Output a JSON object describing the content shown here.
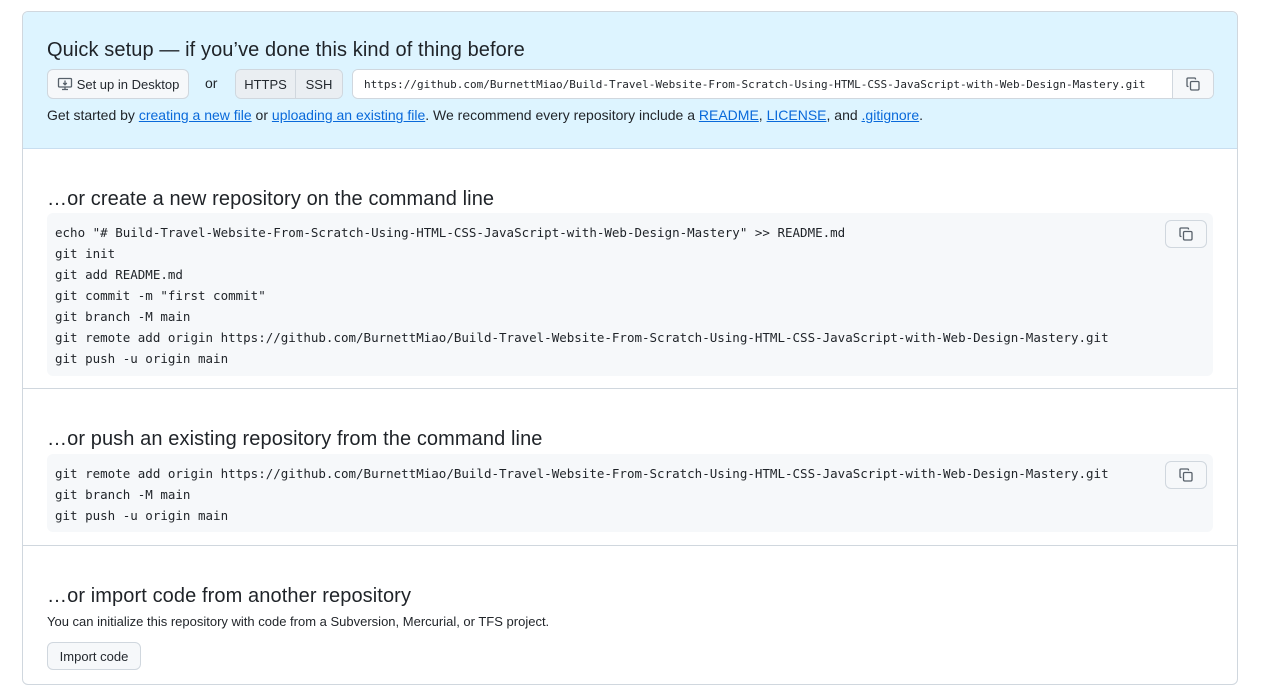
{
  "quick_setup": {
    "title": "Quick setup — if you’ve done this kind of thing before",
    "desktop_button_label": "Set up in Desktop",
    "or_label": "or",
    "protocols": [
      "HTTPS",
      "SSH"
    ],
    "clone_url": "https://github.com/BurnettMiao/Build-Travel-Website-From-Scratch-Using-HTML-CSS-JavaScript-with-Web-Design-Mastery.git",
    "copy_icon": "copy-icon",
    "get_started": {
      "prefix": "Get started by ",
      "link_new_file": "creating a new file",
      "mid1": " or ",
      "link_upload": "uploading an existing file",
      "mid2": ". We recommend every repository include a ",
      "link_readme": "README",
      "comma": ", ",
      "link_license": "LICENSE",
      "and": ", and ",
      "link_gitignore": ".gitignore",
      "end": "."
    }
  },
  "create_section": {
    "title": "…or create a new repository on the command line",
    "lines": [
      "echo \"# Build-Travel-Website-From-Scratch-Using-HTML-CSS-JavaScript-with-Web-Design-Mastery\" >> README.md",
      "git init",
      "git add README.md",
      "git commit -m \"first commit\"",
      "git branch -M main",
      "git remote add origin https://github.com/BurnettMiao/Build-Travel-Website-From-Scratch-Using-HTML-CSS-JavaScript-with-Web-Design-Mastery.git",
      "git push -u origin main"
    ]
  },
  "push_section": {
    "title": "…or push an existing repository from the command line",
    "lines": [
      "git remote add origin https://github.com/BurnettMiao/Build-Travel-Website-From-Scratch-Using-HTML-CSS-JavaScript-with-Web-Design-Mastery.git",
      "git branch -M main",
      "git push -u origin main"
    ]
  },
  "import_section": {
    "title": "…or import code from another repository",
    "description": "You can initialize this repository with code from a Subversion, Mercurial, or TFS project.",
    "button_label": "Import code"
  },
  "colors": {
    "quick_setup_bg": "#ddf4ff",
    "link": "#0969da",
    "code_bg": "#f6f8fa",
    "border": "#d0d7de"
  }
}
